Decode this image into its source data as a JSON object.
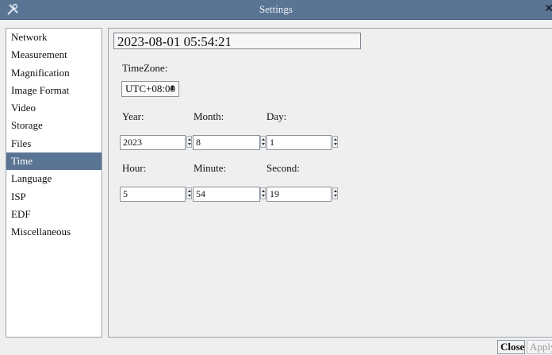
{
  "window": {
    "title": "Settings",
    "close_glyph": "✕",
    "app_icon": "tools-icon"
  },
  "sidebar": {
    "items": [
      {
        "label": "Network"
      },
      {
        "label": "Measurement"
      },
      {
        "label": "Magnification"
      },
      {
        "label": "Image Format"
      },
      {
        "label": "Video"
      },
      {
        "label": "Storage"
      },
      {
        "label": "Files"
      },
      {
        "label": "Time",
        "active": true
      },
      {
        "label": "Language"
      },
      {
        "label": "ISP"
      },
      {
        "label": "EDF"
      },
      {
        "label": "Miscellaneous"
      }
    ]
  },
  "time": {
    "current_datetime": "2023-08-01 05:54:21",
    "timezone_label": "TimeZone:",
    "timezone_value": "UTC+08:00",
    "year_label": "Year:",
    "month_label": "Month:",
    "day_label": "Day:",
    "year_value": "2023",
    "month_value": "8",
    "day_value": "1",
    "hour_label": "Hour:",
    "minute_label": "Minute:",
    "second_label": "Second:",
    "hour_value": "5",
    "minute_value": "54",
    "second_value": "19"
  },
  "buttons": {
    "close_label": "Close",
    "apply_label": "Apply"
  },
  "colors": {
    "accent": "#5a7594",
    "panel": "#efefef"
  }
}
